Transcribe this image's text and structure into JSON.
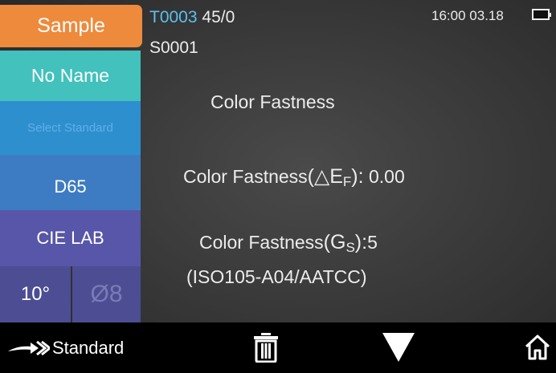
{
  "sidebar": {
    "sample_label": "Sample",
    "name_label": "No Name",
    "standard_label": "Select Standard",
    "illuminant_label": "D65",
    "color_space_label": "CIE LAB",
    "observer_label": "10°",
    "aperture_label": "Ø8"
  },
  "header": {
    "test_id": "T0003",
    "geometry": "45/0",
    "sample_id": "S0001",
    "time": "16:00",
    "date": "03.18"
  },
  "main": {
    "title": "Color Fastness",
    "delta_e_label": "Color Fastness",
    "delta_e_symbol_open": "(",
    "delta_e_symbol": "△E",
    "delta_e_sub": "F",
    "delta_e_symbol_close": "):",
    "delta_e_value": "0.00",
    "gs_label": "Color Fastness",
    "gs_symbol_open": "(",
    "gs_symbol": "G",
    "gs_sub": "S",
    "gs_symbol_close": "):",
    "gs_value": "5",
    "standard_ref": "(ISO105-A04/AATCC)"
  },
  "bottom_bar": {
    "standard_label": "Standard",
    "icons": [
      "arrow-right-icon",
      "trash-icon",
      "triangle-down-icon",
      "home-icon"
    ]
  },
  "colors": {
    "sample": "#ee8a3c",
    "name": "#42c1bd",
    "standard": "#2e8fcf",
    "illuminant": "#3d7cc2",
    "color_space": "#5856a8",
    "observer": "#4c4d93",
    "test_id": "#5bc0ec"
  }
}
